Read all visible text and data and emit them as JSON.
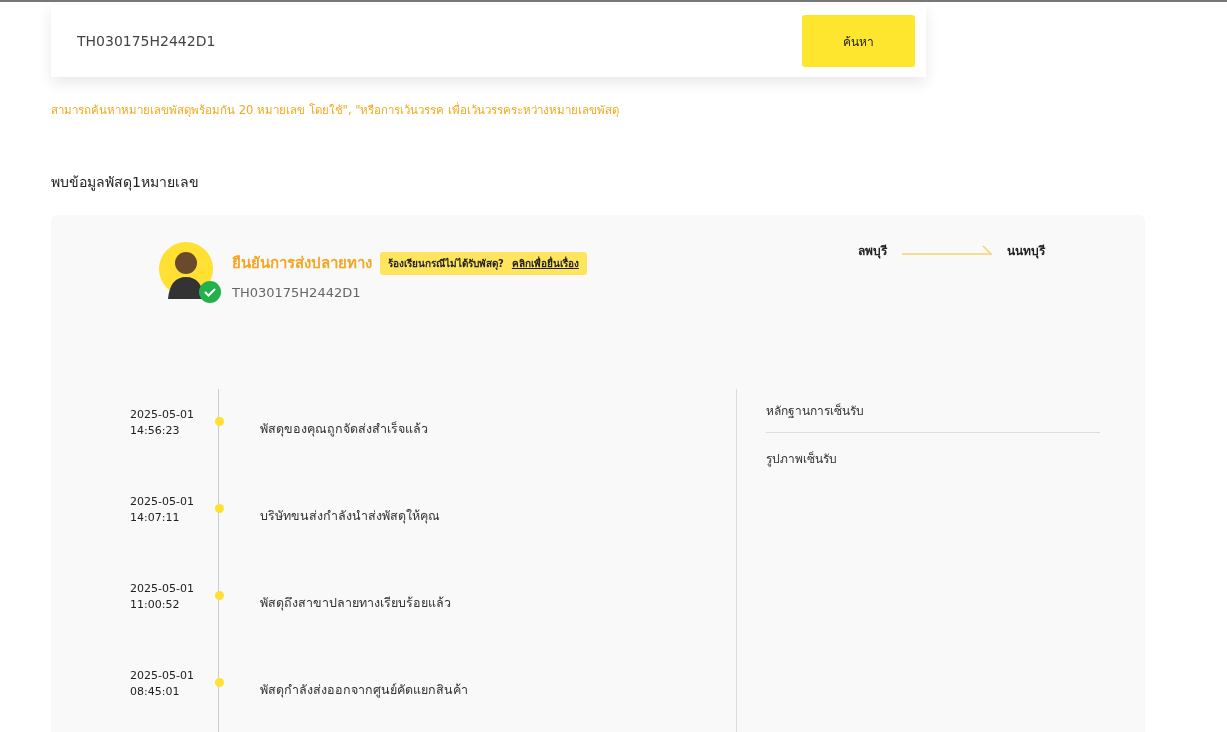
{
  "search": {
    "value": "TH030175H2442D1",
    "button": "ค้นหา"
  },
  "hint": "สามารถค้นหาหมายเลขพัสดุพร้อมกัน 20 หมายเลข โดยใช้\", \"หรือการเว้นวรรค เพื่อเว้นวรรคระหว่างหมายเลขพัสดุ",
  "result_heading": "พบข้อมูลพัสดุ1หมายเลข",
  "parcel": {
    "status": "ยืนยันการส่งปลายทาง",
    "delivered": true,
    "complaint": {
      "text": "ร้องเรียนกรณีไม่ได้รับพัสดุ?",
      "link": "คลิกเพื่อยื่นเรื่อง"
    },
    "tracking_number": "TH030175H2442D1",
    "origin": "ลพบุรี",
    "destination": "นนทบุรี"
  },
  "timeline": [
    {
      "date": "2025-05-01",
      "time": "14:56:23",
      "event": "พัสดุของคุณถูกจัดส่งสำเร็จแล้ว"
    },
    {
      "date": "2025-05-01",
      "time": "14:07:11",
      "event": "บริษัทขนส่งกำลังนำส่งพัสดุให้คุณ"
    },
    {
      "date": "2025-05-01",
      "time": "11:00:52",
      "event": "พัสดุถึงสาขาปลายทางเรียบร้อยแล้ว"
    },
    {
      "date": "2025-05-01",
      "time": "08:45:01",
      "event": "พัสดุกำลังส่งออกจากศูนย์คัดแยกสินค้า"
    }
  ],
  "proof": {
    "title": "หลักฐานการเซ็นรับ",
    "photo_label": "รูปภาพเซ็นรับ"
  }
}
